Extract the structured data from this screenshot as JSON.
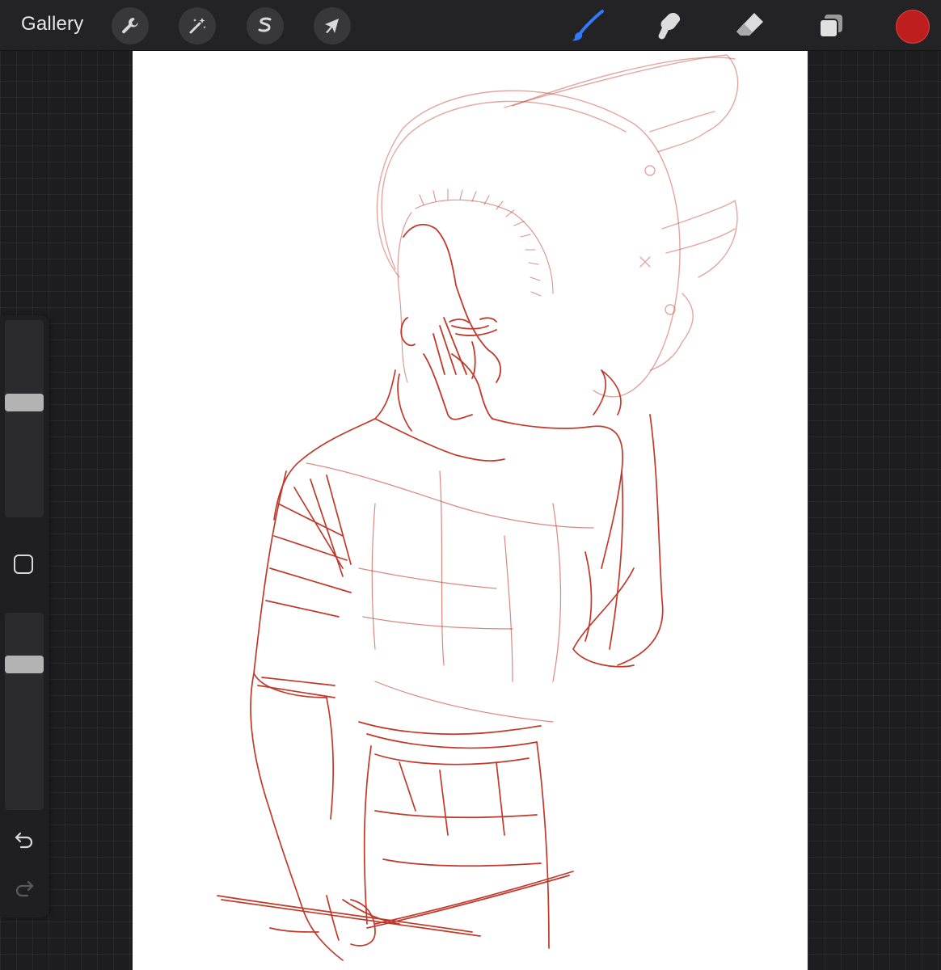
{
  "topbar": {
    "gallery_label": "Gallery",
    "left_tools": [
      {
        "name": "actions",
        "icon": "wrench-icon"
      },
      {
        "name": "adjustments",
        "icon": "magic-wand-icon"
      },
      {
        "name": "selection",
        "icon": "selection-s-icon"
      },
      {
        "name": "transform",
        "icon": "arrow-cursor-icon"
      }
    ],
    "right_tools": [
      {
        "name": "brush",
        "icon": "brush-icon",
        "active": true
      },
      {
        "name": "smudge",
        "icon": "smudge-icon",
        "active": false
      },
      {
        "name": "eraser",
        "icon": "eraser-icon",
        "active": false
      },
      {
        "name": "layers",
        "icon": "layers-icon",
        "active": false
      }
    ],
    "current_color": "#bf1e1e"
  },
  "sidebar": {
    "brush_size_level": 0.59,
    "brush_opacity_level": 0.76
  },
  "theme": {
    "accent": "#2f7bff",
    "stroke_color": "#b42828"
  }
}
